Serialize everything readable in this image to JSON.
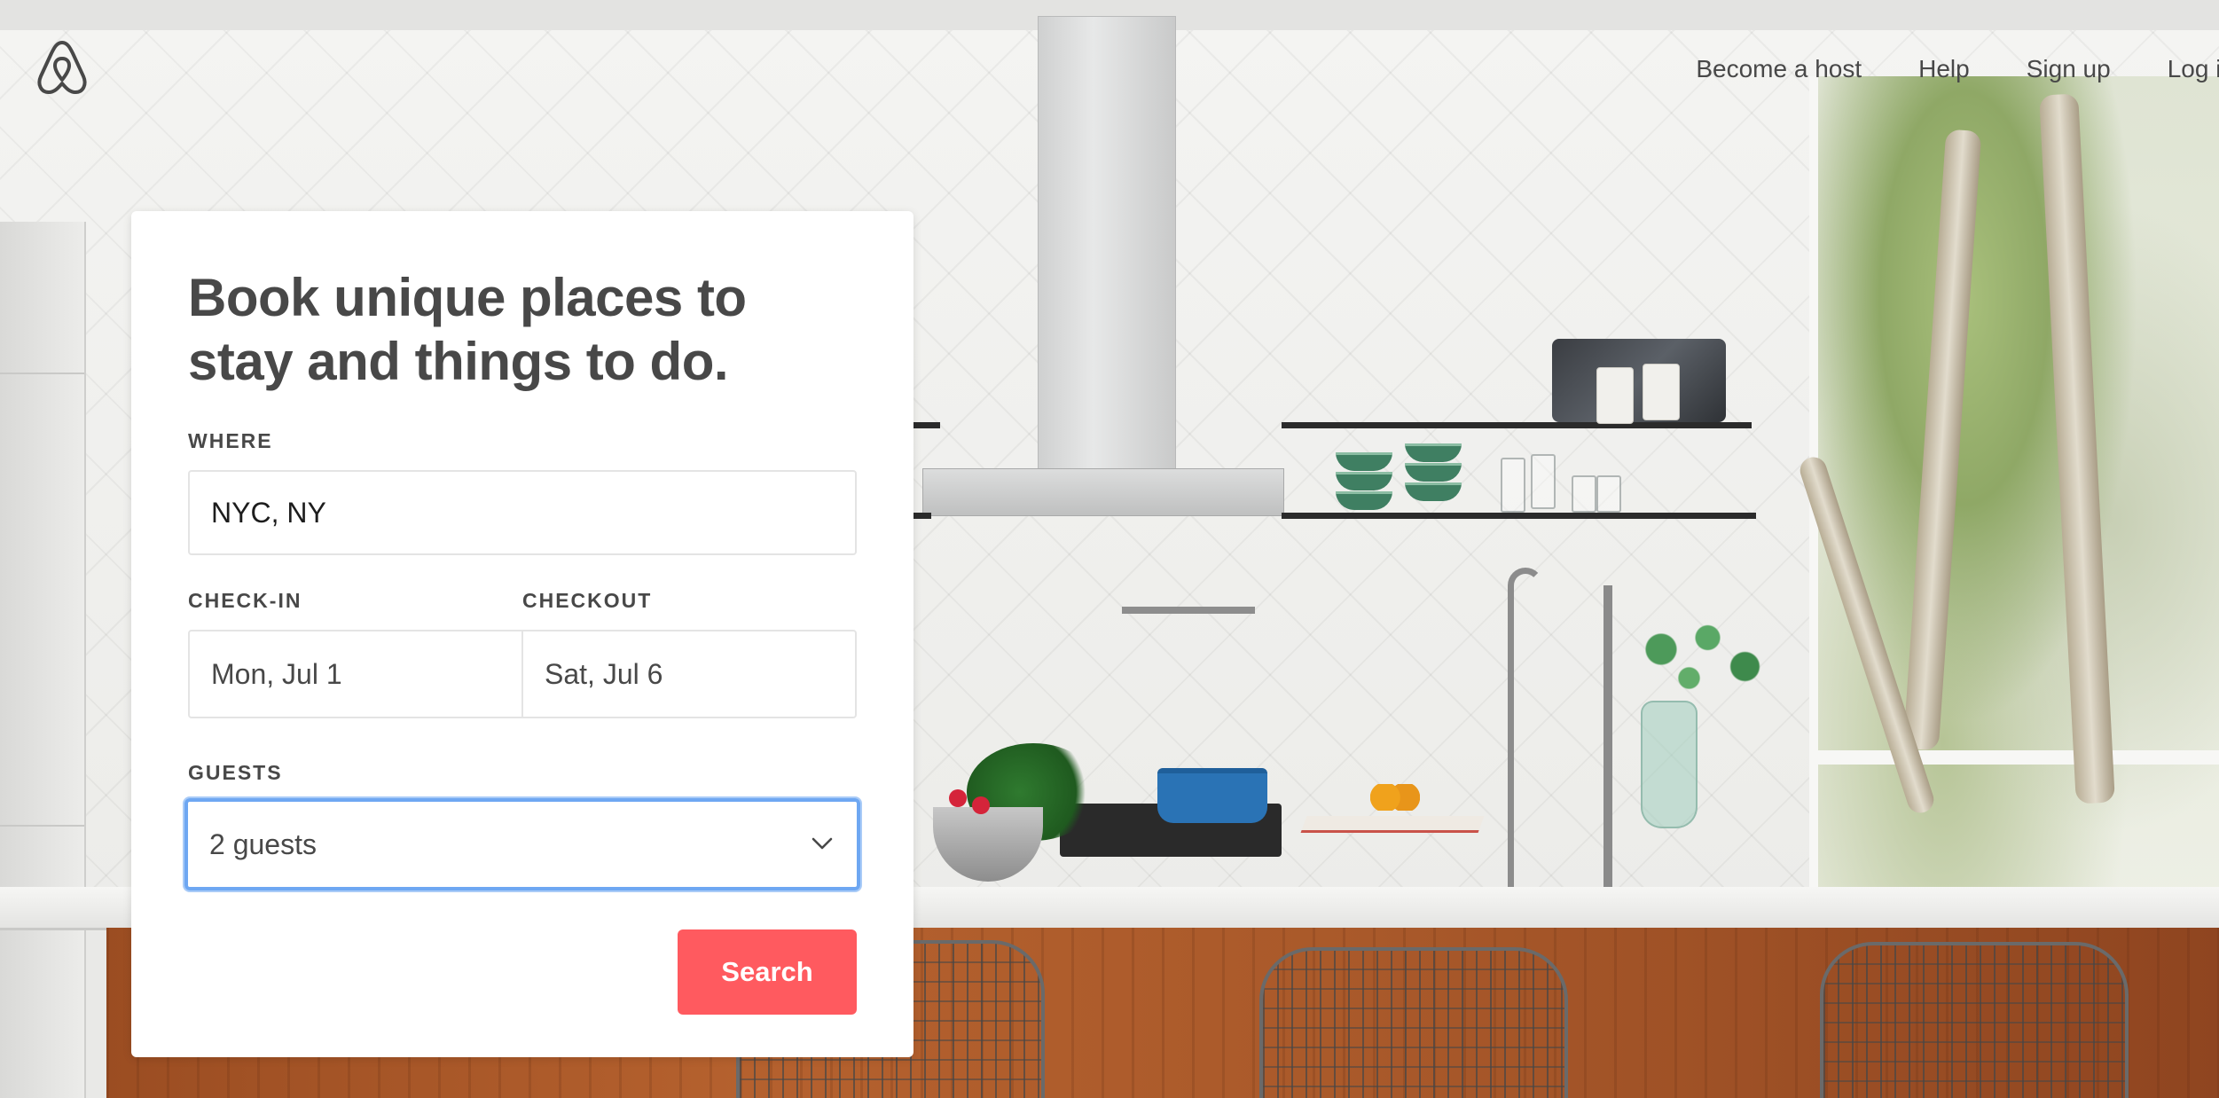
{
  "brand": {
    "logo_icon": "airbnb-belo-icon",
    "accent_color": "#FF5A5F",
    "text_color": "#484848",
    "focus_ring_color": "#6EA7F2"
  },
  "nav": {
    "become_host": "Become a host",
    "help": "Help",
    "sign_up": "Sign up",
    "log_in": "Log in"
  },
  "search_card": {
    "headline": "Book unique places to stay and things to do.",
    "where": {
      "label": "WHERE",
      "value": "NYC, NY"
    },
    "check_in": {
      "label": "CHECK-IN",
      "value": "Mon, Jul 1"
    },
    "checkout": {
      "label": "CHECKOUT",
      "value": "Sat, Jul 6"
    },
    "guests": {
      "label": "GUESTS",
      "selected": "2 guests",
      "icon": "chevron-down-icon"
    },
    "search_button": "Search"
  }
}
